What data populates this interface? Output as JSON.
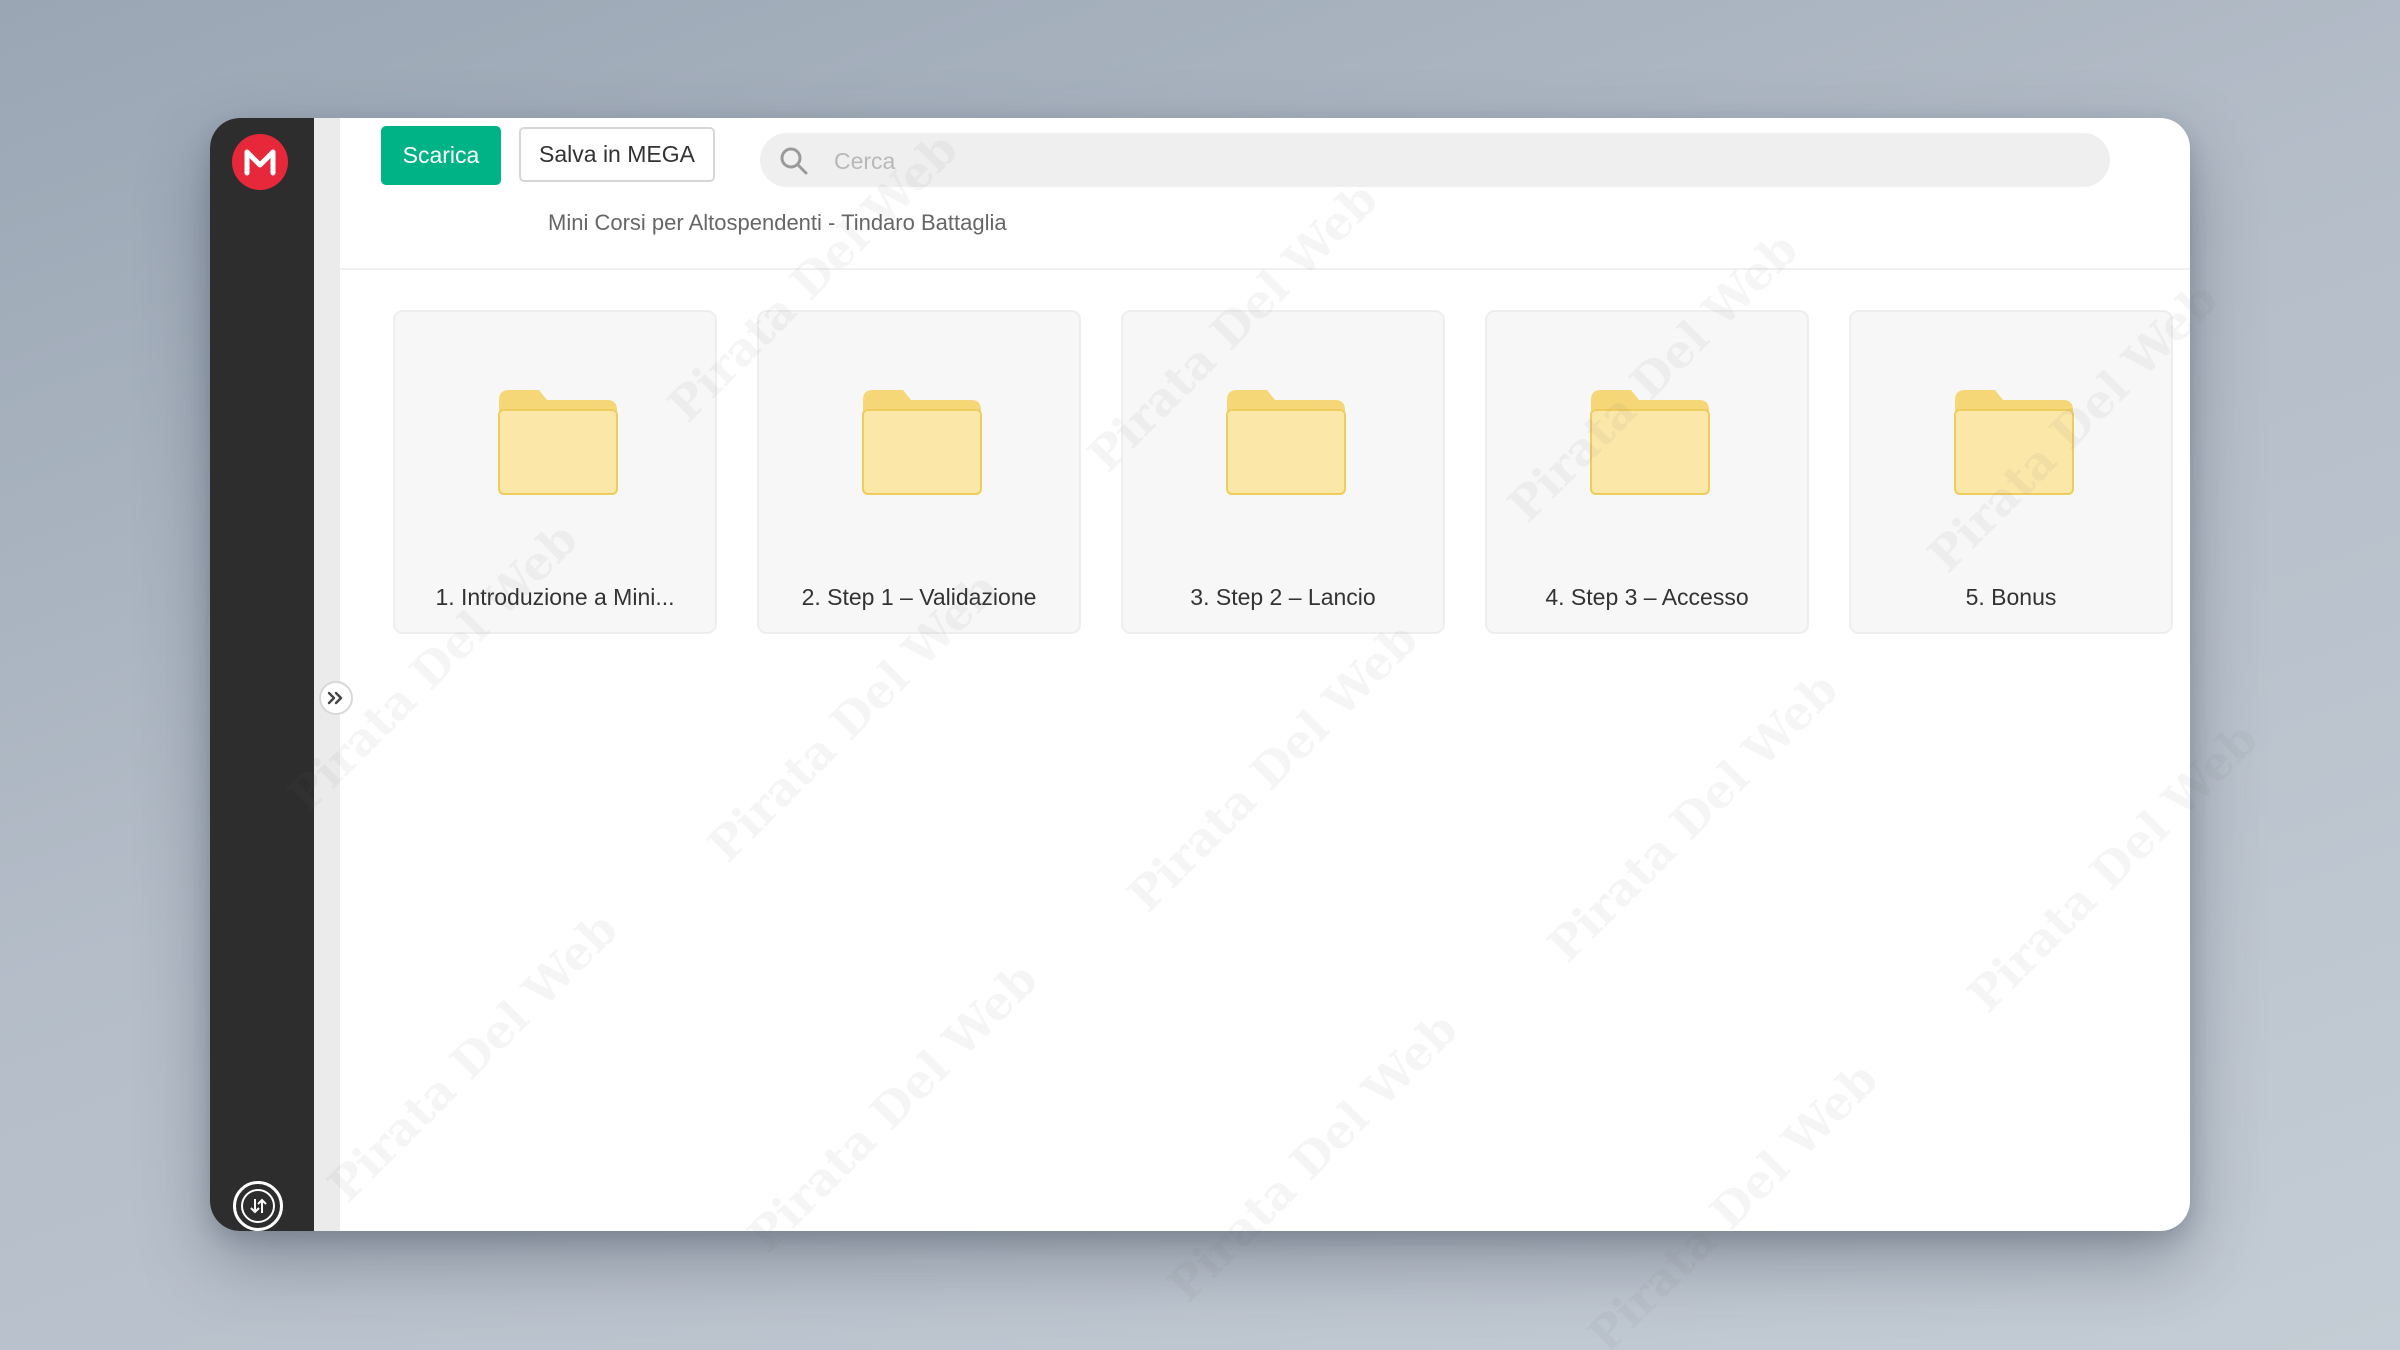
{
  "toolbar": {
    "download_label": "Scarica",
    "save_label": "Salva in MEGA"
  },
  "search": {
    "placeholder": "Cerca"
  },
  "breadcrumb": "Mini Corsi per Altospendenti - Tindaro Battaglia",
  "folders": [
    {
      "label": "1. Introduzione a Mini..."
    },
    {
      "label": "2. Step 1 – Validazione"
    },
    {
      "label": "3. Step 2 – Lancio"
    },
    {
      "label": "4. Step 3 – Accesso"
    },
    {
      "label": "5. Bonus"
    }
  ],
  "watermark": "Pirata Del Web",
  "colors": {
    "brand": "#e6283a",
    "download_button": "#00b387",
    "sidebar": "#2d2d2d",
    "folder": "#fbe7a8"
  },
  "icons": {
    "logo": "mega-logo-icon",
    "search": "search-icon",
    "expand": "double-chevron-right-icon",
    "folder": "folder-icon",
    "transfers": "transfer-icon"
  }
}
